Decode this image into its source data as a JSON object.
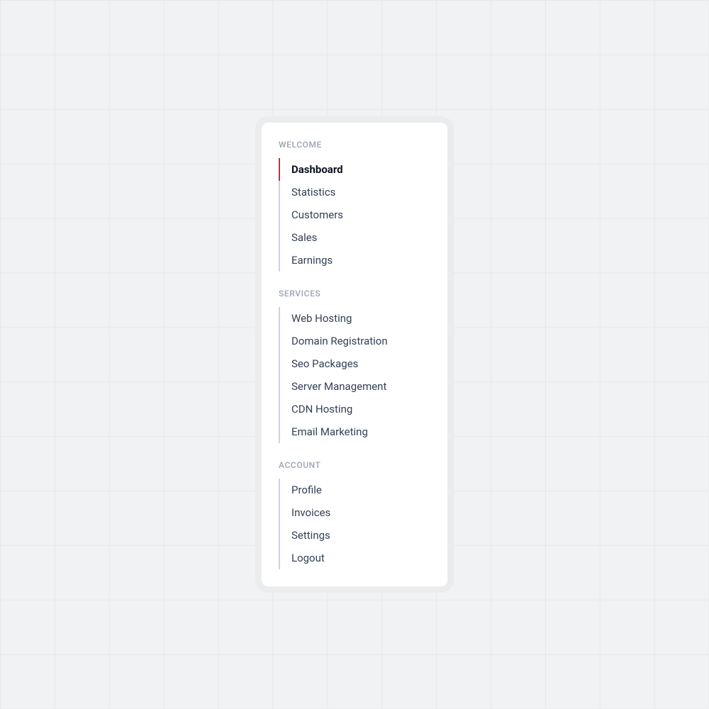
{
  "sidebar": {
    "sections": [
      {
        "header": "Welcome",
        "items": [
          {
            "label": "Dashboard",
            "active": true
          },
          {
            "label": "Statistics",
            "active": false
          },
          {
            "label": "Customers",
            "active": false
          },
          {
            "label": "Sales",
            "active": false
          },
          {
            "label": "Earnings",
            "active": false
          }
        ]
      },
      {
        "header": "Services",
        "items": [
          {
            "label": "Web Hosting",
            "active": false
          },
          {
            "label": "Domain Registration",
            "active": false
          },
          {
            "label": "Seo Packages",
            "active": false
          },
          {
            "label": "Server Management",
            "active": false
          },
          {
            "label": "CDN Hosting",
            "active": false
          },
          {
            "label": "Email Marketing",
            "active": false
          }
        ]
      },
      {
        "header": "Account",
        "items": [
          {
            "label": "Profile",
            "active": false
          },
          {
            "label": "Invoices",
            "active": false
          },
          {
            "label": "Settings",
            "active": false
          },
          {
            "label": "Logout",
            "active": false
          }
        ]
      }
    ]
  }
}
